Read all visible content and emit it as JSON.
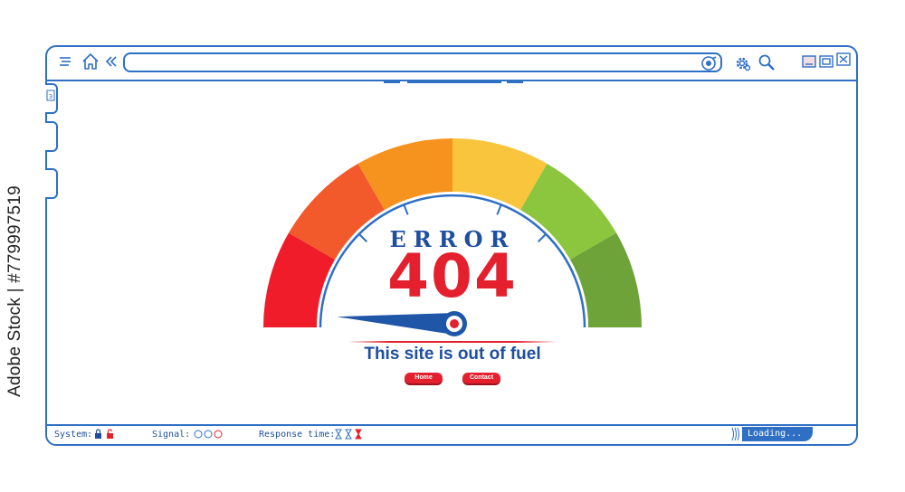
{
  "watermark": {
    "side_text": "Adobe Stock | #779997519"
  },
  "browser": {
    "toolbar_icons": [
      "menu-icon",
      "home-icon",
      "back-double-chevron-icon",
      "target-icon",
      "gear-icon",
      "search-magnifier-icon"
    ],
    "window_controls": [
      "minimize-icon",
      "restore-icon",
      "close-icon"
    ],
    "side_tab_badge": "3"
  },
  "main": {
    "error_label": "ERROR",
    "error_code": "404",
    "message": "This site is out of fuel",
    "buttons": {
      "home": "Home",
      "contact": "Contact"
    }
  },
  "gauge": {
    "segment_colors": [
      "#f01c2a",
      "#f25a2b",
      "#f6931e",
      "#f9c53c",
      "#8cc63f",
      "#6ea33a"
    ],
    "needle_color": "#1f56a8",
    "needle_level": 0.0,
    "accent": "#2f6fc4",
    "red": "#e5202e"
  },
  "status_bar": {
    "system_label": "System:",
    "signal_label": "Signal:",
    "response_label": "Response time:",
    "loading_text": "Loading..."
  }
}
